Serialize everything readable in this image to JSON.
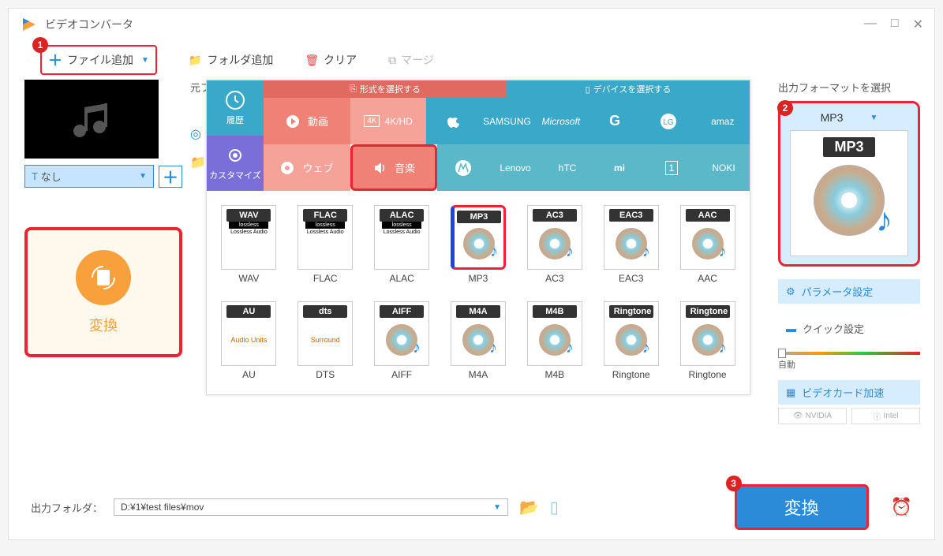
{
  "app": {
    "title": "ビデオコンバータ"
  },
  "toolbar": {
    "add_file": "ファイル追加",
    "add_folder": "フォルダ追加",
    "clear": "クリア",
    "merge": "マージ"
  },
  "left": {
    "combo_none": "なし",
    "convert": "変換"
  },
  "mid_head": {
    "source": "元フ"
  },
  "picker": {
    "side": {
      "history": "履歴",
      "customize": "カスタマイズ"
    },
    "header": {
      "format": "形式を選択する",
      "device": "デバイスを選択する"
    },
    "cats": {
      "video": "動画",
      "fourk": "4K/HD",
      "web": "ウェブ",
      "music": "音楽"
    },
    "brands_row1": [
      "",
      "SAMSUNG",
      "Microsoft",
      "G",
      "",
      "amaz"
    ],
    "brands_row2": [
      "",
      "Lenovo",
      "hTC",
      "mi",
      "",
      "NOKI"
    ]
  },
  "formats": [
    {
      "hdr": "WAV",
      "lbl": "WAV",
      "lossless": true
    },
    {
      "hdr": "FLAC",
      "lbl": "FLAC",
      "lossless": true
    },
    {
      "hdr": "ALAC",
      "lbl": "ALAC",
      "lossless": true
    },
    {
      "hdr": "MP3",
      "lbl": "MP3",
      "sel": true
    },
    {
      "hdr": "AC3",
      "lbl": "AC3"
    },
    {
      "hdr": "EAC3",
      "lbl": "EAC3"
    },
    {
      "hdr": "AAC",
      "lbl": "AAC"
    },
    {
      "hdr": "AU",
      "lbl": "AU",
      "sub": "Audio Units"
    },
    {
      "hdr": "dts",
      "lbl": "DTS",
      "sub": "Surround"
    },
    {
      "hdr": "AIFF",
      "lbl": "AIFF"
    },
    {
      "hdr": "M4A",
      "lbl": "M4A"
    },
    {
      "hdr": "M4B",
      "lbl": "M4B"
    },
    {
      "hdr": "Ringtone",
      "lbl": "Ringtone"
    },
    {
      "hdr": "Ringtone",
      "lbl": "Ringtone"
    }
  ],
  "right": {
    "title": "出力フォーマットを選択",
    "selected": "MP3",
    "param": "パラメータ設定",
    "quick": "クイック設定",
    "slider_auto": "自動",
    "gpu": "ビデオカード加速",
    "nvidia": "NVIDIA",
    "intel": "Intel"
  },
  "footer": {
    "label": "出力フォルダ：",
    "path": "D:¥1¥test files¥mov",
    "convert": "変換"
  },
  "badges": {
    "one": "1",
    "two": "2",
    "three": "3"
  }
}
